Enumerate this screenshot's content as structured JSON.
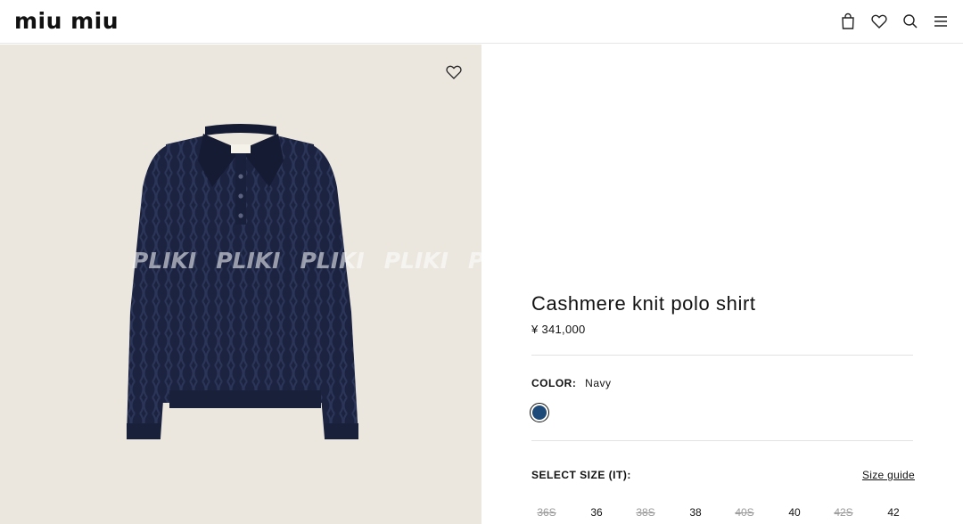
{
  "header": {
    "logo": "MIU MIU",
    "icons": [
      "bag-icon",
      "heart-icon",
      "search-icon",
      "menu-icon"
    ]
  },
  "media": {
    "watermark": [
      "PLIKI",
      "PLIKI",
      "PLIKI",
      "PLIKI",
      "PL"
    ],
    "background": "#ebe7df",
    "product_color": "#1c2340",
    "label_text": "Miu Miu"
  },
  "product": {
    "title": "Cashmere knit polo shirt",
    "price": "¥ 341,000",
    "color_label": "COLOR:",
    "color_value": "Navy",
    "swatch_color": "#1d4a78",
    "size_title": "SELECT SIZE (IT):",
    "size_guide": "Size guide",
    "sizes": [
      {
        "label": "36S",
        "available": false
      },
      {
        "label": "36",
        "available": true
      },
      {
        "label": "38S",
        "available": false
      },
      {
        "label": "38",
        "available": true
      },
      {
        "label": "40S",
        "available": false
      },
      {
        "label": "40",
        "available": true
      },
      {
        "label": "42S",
        "available": false
      },
      {
        "label": "42",
        "available": true
      }
    ]
  }
}
